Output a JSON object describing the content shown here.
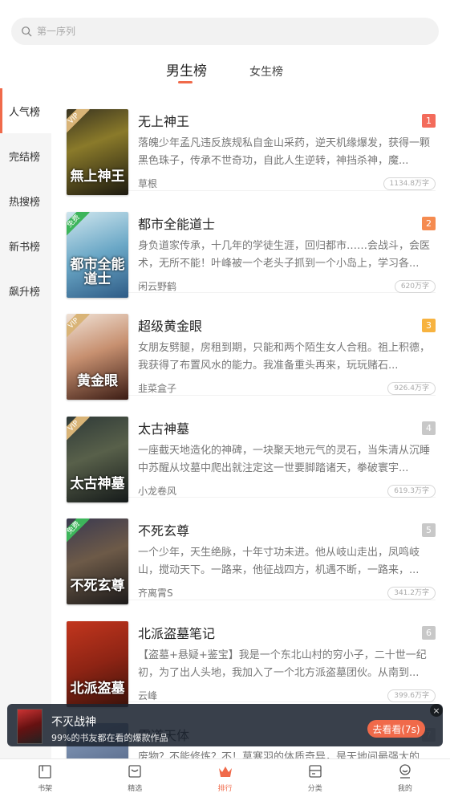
{
  "search": {
    "placeholder": "第一序列"
  },
  "gender_tabs": [
    {
      "label": "男生榜",
      "active": true
    },
    {
      "label": "女生榜",
      "active": false
    }
  ],
  "sidebar": {
    "items": [
      {
        "label": "人气榜",
        "active": true
      },
      {
        "label": "完结榜",
        "active": false
      },
      {
        "label": "热搜榜",
        "active": false
      },
      {
        "label": "新书榜",
        "active": false
      },
      {
        "label": "飙升榜",
        "active": false
      }
    ]
  },
  "books": [
    {
      "title": "无上神王",
      "rank": "1",
      "rank_color": "#f36b5b",
      "desc": "落魄少年孟凡违反族规私自金山采药，逆天机缘爆发，获得一颗黑色珠子，传承不世奇功，自此人生逆转，神挡杀神，魔...",
      "author": "草根",
      "words": "1134.8万字",
      "tag": "VIP",
      "cover_text": "無上神王",
      "cover_bg": "linear-gradient(160deg,#3a3420 0%,#8a7a2a 40%,#1d1a10 100%)"
    },
    {
      "title": "都市全能道士",
      "rank": "2",
      "rank_color": "#f58b50",
      "desc": "身负道家传承，十几年的学徒生涯，回归都市……会战斗，会医术，无所不能！叶峰被一个老头子抓到一个小岛上，学习各...",
      "author": "闲云野鹤",
      "words": "620万字",
      "tag": "免费",
      "cover_text": "都市全能道士",
      "cover_bg": "linear-gradient(160deg,#cfe6ee 0%,#6aa7c6 50%,#2e5b86 100%)"
    },
    {
      "title": "超级黄金眼",
      "rank": "3",
      "rank_color": "#f7b340",
      "desc": "女朋友劈腿，房租到期，只能和两个陌生女人合租。祖上积德，我获得了布置风水的能力。我准备重头再来，玩玩赌石...",
      "author": "韭菜盒子",
      "words": "926.4万字",
      "tag": "VIP",
      "cover_text": "黄金眼",
      "cover_bg": "linear-gradient(160deg,#f0e2d6 0%,#c79070 45%,#3b1c14 100%)"
    },
    {
      "title": "太古神墓",
      "rank": "4",
      "rank_color": "#c8c8c8",
      "desc": "一座截天地造化的神碑，一块聚天地元气的灵石，当朱清从沉睡中苏醒从坟墓中爬出就注定这一世要脚踏诸天，拳破寰宇...",
      "author": "小龙卷风",
      "words": "619.3万字",
      "tag": "VIP",
      "cover_text": "太古神墓",
      "cover_bg": "linear-gradient(160deg,#2f3a38 0%,#58604a 45%,#151a1a 100%)"
    },
    {
      "title": "不死玄尊",
      "rank": "5",
      "rank_color": "#c8c8c8",
      "desc": "一个少年，天生绝脉，十年寸功未进。他从岐山走出，凤鸣岐山，搅动天下。一路来，他征战四方，机遇不断，一路来，...",
      "author": "齐离霄S",
      "words": "341.2万字",
      "tag": "免费",
      "cover_text": "不死玄尊",
      "cover_bg": "linear-gradient(160deg,#3b3a50 0%,#6d5a48 45%,#1c1a1a 100%)"
    },
    {
      "title": "北派盗墓笔记",
      "rank": "6",
      "rank_color": "#c8c8c8",
      "desc": "【盗墓+悬疑+鉴宝】我是一个东北山村的穷小子，二十世一纪初，为了出人头地，我加入了一个北方派盗墓团伙。从南到...",
      "author": "云峰",
      "words": "399.6万字",
      "tag": "",
      "cover_text": "北派盗墓",
      "cover_bg": "linear-gradient(160deg,#c2361e 0%,#8e2414 50%,#3a120a 100%)"
    },
    {
      "title": "霸道天体",
      "rank": "7",
      "rank_color": "#c8c8c8",
      "desc": "废物？不能修炼？不！莫寒羽的体质奇异，是天地间最强大的...",
      "author": "",
      "words": "",
      "tag": "",
      "cover_text": "",
      "cover_bg": "linear-gradient(160deg,#8aa0c0 0%,#3a4a6a 100%)"
    }
  ],
  "banner": {
    "title": "不灭战神",
    "subtitle": "99%的书友都在看的爆款作品",
    "button": "去看看(7s)",
    "close": "×"
  },
  "bottom_nav": [
    {
      "label": "书架",
      "icon": "bookshelf-icon",
      "active": false
    },
    {
      "label": "精选",
      "icon": "featured-icon",
      "active": false
    },
    {
      "label": "排行",
      "icon": "crown-icon",
      "active": true
    },
    {
      "label": "分类",
      "icon": "category-icon",
      "active": false
    },
    {
      "label": "我的",
      "icon": "profile-icon",
      "active": false
    }
  ]
}
